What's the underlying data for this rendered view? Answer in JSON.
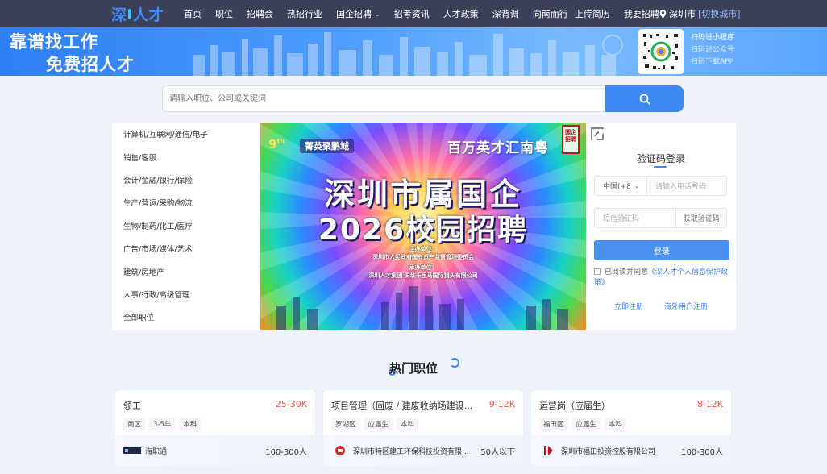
{
  "brand": {
    "logo_left": "深",
    "logo_right": "人才"
  },
  "nav": {
    "items": [
      {
        "label": "首页"
      },
      {
        "label": "职位"
      },
      {
        "label": "招聘会"
      },
      {
        "label": "热招行业"
      },
      {
        "label": "国企招聘"
      },
      {
        "label": "招考资讯"
      },
      {
        "label": "人才政策"
      },
      {
        "label": "深背调"
      },
      {
        "label": "向南而行"
      },
      {
        "label": "上传简历"
      },
      {
        "label": "我要招聘"
      }
    ],
    "city": "深圳市",
    "city_switch": "[切换城市]"
  },
  "banner": {
    "slogan_1": "靠谱找工作",
    "slogan_2": "免费招人才",
    "qr_links": [
      "扫码进小程序",
      "扫码进公众号",
      "扫码下载APP"
    ]
  },
  "search": {
    "placeholder": "请输入职位、公司或关键词"
  },
  "categories": [
    "计算机/互联网/通信/电子",
    "销售/客服",
    "会计/金融/银行/保险",
    "生产/营运/采购/物流",
    "生物/制药/化工/医疗",
    "广告/市场/媒体/艺术",
    "建筑/房地产",
    "人事/行政/高级管理",
    "全部职位"
  ],
  "promo": {
    "edition": "9",
    "edition_suffix": "th",
    "brand": "菁英聚鹏城",
    "slogan": "百万英才汇南粤",
    "seal": "国企招聘",
    "title_1": "深圳市属国企",
    "title_2": "2026校园招聘",
    "host_label": "主办单位：",
    "host": "深圳市人民政府国有资产监督管理委员会",
    "organizer_label": "承办单位：",
    "organizer": "深圳人才集团 深圳千里马国际猎头有限公司"
  },
  "login": {
    "title": "验证码登录",
    "country_code": "中国(+8",
    "phone_placeholder": "请输入电话号码",
    "code_placeholder": "短信验证码",
    "get_code": "获取验证码",
    "submit": "登录",
    "agree_prefix": "已阅读并同意",
    "policy": "《深人才个人信息保护政策》",
    "register": "立即注册",
    "overseas": "海外用户注册"
  },
  "hot_jobs": {
    "title": "热门职位",
    "items": [
      {
        "title": "领工",
        "salary": "25-30K",
        "tags": [
          "南区",
          "3-5年",
          "本科"
        ],
        "company": "海职通",
        "size": "100-300人"
      },
      {
        "title": "项目管理（固废 / 建废收纳场建设...",
        "salary": "9-12K",
        "tags": [
          "罗湖区",
          "应届生",
          "本科"
        ],
        "company": "深圳市特区建工环保科技投资有限...",
        "size": "50人以下"
      },
      {
        "title": "运营岗（应届生）",
        "salary": "8-12K",
        "tags": [
          "福田区",
          "应届生",
          "本科"
        ],
        "company": "深圳市福田投资控股有限公司",
        "size": "100-300人"
      }
    ]
  },
  "colors": {
    "accent": "#3d88f2",
    "salary": "#fe574a",
    "nav_bg": "#3b3f58"
  }
}
